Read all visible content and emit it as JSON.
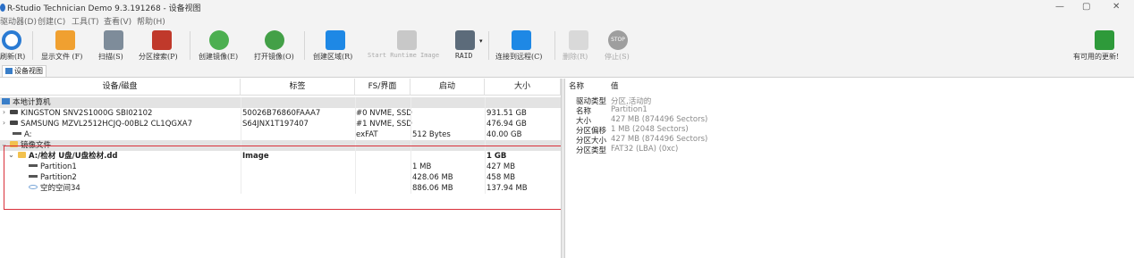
{
  "window": {
    "title": "R-Studio Technician Demo 9.3.191268 - 设备视图",
    "controls": {
      "minimize": "—",
      "maximize": "▢",
      "close": "✕"
    }
  },
  "menu": [
    "驱动器(D)",
    "创建(C)",
    "工具(T)",
    "查看(V)",
    "帮助(H)"
  ],
  "toolbar": {
    "buttons": [
      {
        "label": "刷新(R)",
        "icon": "refresh-icon",
        "color": "#2a7bd3"
      },
      {
        "label": "显示文件 (F)",
        "icon": "show-files-icon",
        "color": "#f0a030"
      },
      {
        "label": "扫描(S)",
        "icon": "scan-icon",
        "color": "#5a6c80"
      },
      {
        "label": "分区搜索(P)",
        "icon": "partition-search-icon",
        "color": "#c0392b"
      },
      {
        "label": "创建镜像(E)",
        "icon": "create-image-icon",
        "color": "#4caf50"
      },
      {
        "label": "打开镜像(O)",
        "icon": "open-image-icon",
        "color": "#43a047"
      },
      {
        "label": "创建区域(R)",
        "icon": "create-region-icon",
        "color": "#1e88e5"
      },
      {
        "label": "Start Runtime Image",
        "icon": "runtime-image-icon",
        "color": "#9e9e9e"
      },
      {
        "label": "RAID",
        "icon": "raid-icon",
        "color": "#5c6b7a"
      },
      {
        "label": "连接到远程(C)",
        "icon": "connect-remote-icon",
        "color": "#1e88e5"
      },
      {
        "label": "删除(R)",
        "icon": "delete-icon",
        "color": "#bdbdbd"
      },
      {
        "label": "停止(S)",
        "icon": "stop-icon",
        "color": "#9e9e9e"
      }
    ],
    "update_label": "有可用的更新!",
    "update_color": "#2e9a3a"
  },
  "tab": {
    "label": "设备视图"
  },
  "device_table": {
    "columns": [
      "设备/磁盘",
      "标签",
      "FS/界面",
      "启动",
      "大小"
    ],
    "rows": [
      {
        "name": "本地计算机",
        "label": "",
        "fs": "",
        "start": "",
        "size": ""
      },
      {
        "name": "KINGSTON SNV2S1000G SBI02102",
        "label": "50026B76860FAAA7",
        "fs": "#0 NVME, SSD",
        "start": "",
        "size": "931.51 GB"
      },
      {
        "name": "SAMSUNG MZVL2512HCJQ-00BL2 CL1QGXA7",
        "label": "S64JNX1T197407",
        "fs": "#1 NVME, SSD",
        "start": "",
        "size": "476.94 GB"
      },
      {
        "name": "A:",
        "label": "",
        "fs": "exFAT",
        "start": "512 Bytes",
        "size": "40.00 GB"
      },
      {
        "name": "镜像文件",
        "label": "",
        "fs": "",
        "start": "",
        "size": ""
      },
      {
        "name": "A:/检材 U盘/U盘检材.dd",
        "label": "Image",
        "fs": "",
        "start": "",
        "size": "1 GB"
      },
      {
        "name": "Partition1",
        "label": "",
        "fs": "",
        "start": "1 MB",
        "size": "427 MB"
      },
      {
        "name": "Partition2",
        "label": "",
        "fs": "",
        "start": "428.06 MB",
        "size": "458 MB"
      },
      {
        "name": "空的空间34",
        "label": "",
        "fs": "",
        "start": "886.06 MB",
        "size": "137.94 MB"
      }
    ]
  },
  "properties": {
    "columns": [
      "名称",
      "值"
    ],
    "rows": [
      {
        "key": "驱动类型",
        "value": "分区,活动的"
      },
      {
        "key": "名称",
        "value": "Partition1"
      },
      {
        "key": "大小",
        "value": "427 MB (874496 Sectors)"
      },
      {
        "key": "分区偏移",
        "value": "1 MB (2048 Sectors)"
      },
      {
        "key": "分区大小",
        "value": "427 MB (874496 Sectors)"
      },
      {
        "key": "分区类型",
        "value": "FAT32 (LBA) (0xc)"
      }
    ]
  },
  "highlight_color": "#d9303a"
}
